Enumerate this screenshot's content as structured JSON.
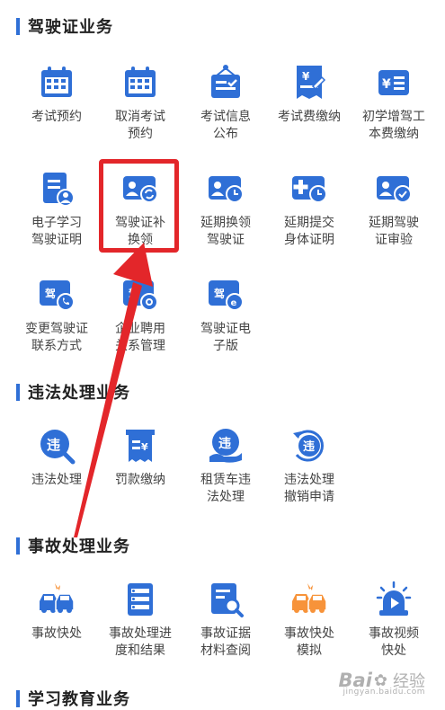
{
  "colors": {
    "primary": "#2f6fd6",
    "orange": "#f7933a",
    "highlight": "#e3262a"
  },
  "sections": [
    {
      "title": "驾驶证业务",
      "items": [
        {
          "label": "考试预约",
          "icon": "calendar-icon"
        },
        {
          "label": "取消考试\n预约",
          "icon": "calendar-cancel-icon"
        },
        {
          "label": "考试信息\n公布",
          "icon": "notice-board-icon"
        },
        {
          "label": "考试费缴纳",
          "icon": "fee-payment-icon"
        },
        {
          "label": "初学增驾工\n本费缴纳",
          "icon": "yuan-card-icon"
        },
        {
          "label": "电子学习\n驾驶证明",
          "icon": "document-user-icon"
        },
        {
          "label": "驾驶证补\n换领",
          "icon": "license-renew-icon"
        },
        {
          "label": "延期换领\n驾驶证",
          "icon": "license-clock-icon"
        },
        {
          "label": "延期提交\n身体证明",
          "icon": "medical-clock-icon"
        },
        {
          "label": "延期驾驶\n证审验",
          "icon": "license-check-icon"
        },
        {
          "label": "变更驾驶证\n联系方式",
          "icon": "license-phone-icon"
        },
        {
          "label": "企业聘用\n关系管理",
          "icon": "license-settings-icon"
        },
        {
          "label": "驾驶证电\n子版",
          "icon": "license-digital-icon"
        }
      ]
    },
    {
      "title": "违法处理业务",
      "items": [
        {
          "label": "违法处理",
          "icon": "violation-search-icon"
        },
        {
          "label": "罚款缴纳",
          "icon": "fine-receipt-icon"
        },
        {
          "label": "租赁车违\n法处理",
          "icon": "rental-violation-icon"
        },
        {
          "label": "违法处理\n撤销申请",
          "icon": "violation-revoke-icon"
        }
      ]
    },
    {
      "title": "事故处理业务",
      "items": [
        {
          "label": "事故快处",
          "icon": "accident-cars-icon"
        },
        {
          "label": "事故处理进\n度和结果",
          "icon": "accident-progress-icon"
        },
        {
          "label": "事故证据\n材料查阅",
          "icon": "evidence-search-icon"
        },
        {
          "label": "事故快处\n模拟",
          "icon": "accident-simulation-icon"
        },
        {
          "label": "事故视频\n快处",
          "icon": "video-alarm-icon"
        }
      ]
    },
    {
      "title": "学习教育业务",
      "items": []
    }
  ],
  "watermark": {
    "logo": "Bai",
    "text": "经验",
    "sub": "jingyan.baidu.com"
  }
}
